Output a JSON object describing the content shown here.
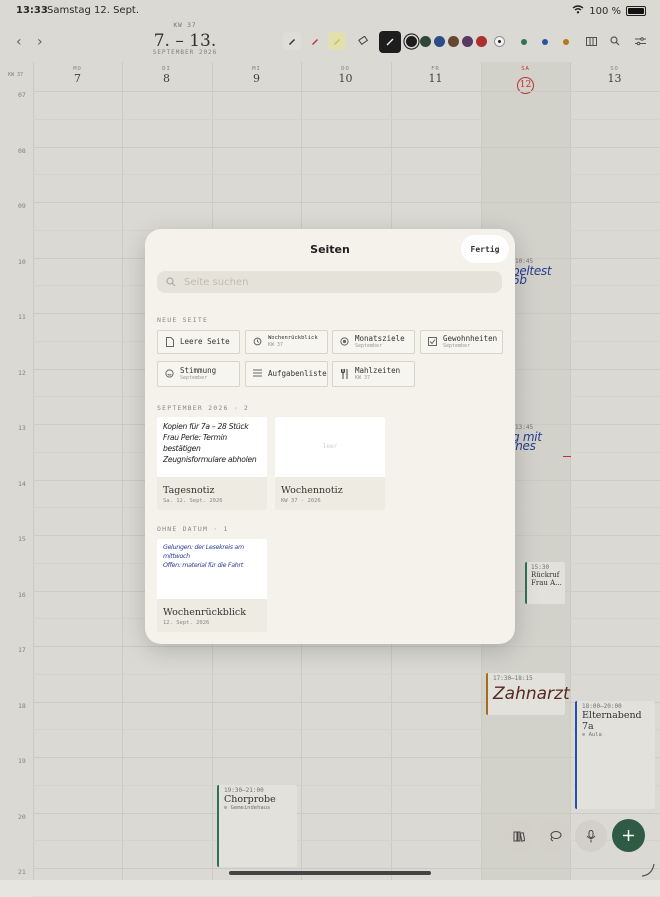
{
  "status": {
    "time": "13:33",
    "date": "Samstag 12. Sept.",
    "battery": "100 %"
  },
  "header": {
    "kw": "KW 37",
    "range": "7. – 13.",
    "month": "SEPTEMBER 2026"
  },
  "calendar": {
    "kw_label": "KW 37",
    "days": [
      {
        "name": "MO",
        "num": "7"
      },
      {
        "name": "DI",
        "num": "8"
      },
      {
        "name": "MI",
        "num": "9"
      },
      {
        "name": "DO",
        "num": "10"
      },
      {
        "name": "FR",
        "num": "11"
      },
      {
        "name": "SA",
        "num": "12"
      },
      {
        "name": "SO",
        "num": "13"
      }
    ],
    "hours": [
      "07",
      "08",
      "09",
      "10",
      "11",
      "12",
      "13",
      "14",
      "15",
      "16",
      "17",
      "18",
      "19",
      "20",
      "21"
    ],
    "events": {
      "test": {
        "time": "10:45",
        "title": "beltest 6b"
      },
      "meeting": {
        "time": "13:45",
        "title": "g mit Ines"
      },
      "rueckruf": {
        "time": "15:30",
        "title": "Rückruf",
        "sub": "Frau A..."
      },
      "zahnarzt": {
        "time": "17:30–18:15",
        "title": "Zahnarzt"
      },
      "elternabend": {
        "time": "18:00–20:00",
        "title": "Elternabend 7a",
        "place": "⊙ Aula"
      },
      "chorprobe": {
        "time": "19:30–21:00",
        "title": "Chorprobe",
        "place": "⊙ Gemeindehaus"
      }
    }
  },
  "modal": {
    "title": "Seiten",
    "done": "Fertig",
    "search_placeholder": "Seite suchen",
    "new_page_header": "NEUE SEITE",
    "new_page_buttons": [
      {
        "label": "Leere Seite",
        "sub": ""
      },
      {
        "label": "Wochenrückblick",
        "sub": "KW 37"
      },
      {
        "label": "Monatsziele",
        "sub": "September"
      },
      {
        "label": "Gewohnheiten",
        "sub": "September"
      },
      {
        "label": "Stimmung",
        "sub": "September"
      },
      {
        "label": "Aufgabenliste",
        "sub": ""
      },
      {
        "label": "Mahlzeiten",
        "sub": "KW 37"
      }
    ],
    "sept_header": "SEPTEMBER 2026 · 2",
    "sept_cards": [
      {
        "title": "Tagesnotiz",
        "meta": "Sa. 12. Sept. 2026",
        "preview": "Kopien für 7a – 28 Stück\nFrau Perle: Termin bestätigen\nZeugnisformulare abholen"
      },
      {
        "title": "Wochennotiz",
        "meta": "KW 37 · 2026",
        "preview": "leer"
      }
    ],
    "undated_header": "OHNE DATUM · 1",
    "undated_cards": [
      {
        "title": "Wochenrückblick",
        "meta": "12. Sept. 2026",
        "preview": "Gelungen: der Lesekreis am mittwoch\nOffen: material für die Fahrt"
      }
    ]
  },
  "colors": {
    "accent": "#2f5a44",
    "ink": "#1d1d1d",
    "red": "#c6363a",
    "today": "#c6363a"
  }
}
